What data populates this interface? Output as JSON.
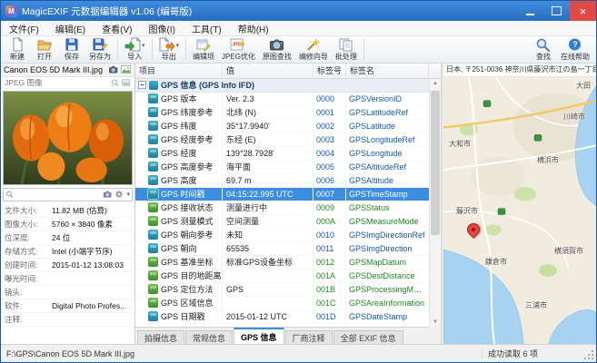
{
  "window": {
    "title": "MagicEXIF 元数据编辑器 v1.06 (编哥版)"
  },
  "menu": {
    "items": [
      "文件(F)",
      "编辑(E)",
      "查看(V)",
      "图像(I)",
      "工具(T)",
      "帮助(H)"
    ]
  },
  "toolbar": {
    "new": "新建",
    "open": "打开",
    "save": "保存",
    "save_as": "另存为",
    "import": "导入",
    "export": "导出",
    "edit_items": "编辑项",
    "jpeg_optimize": "JPEG优化",
    "original_search": "原图查找",
    "wizard": "编修向导",
    "batch": "批处理",
    "find": "查找",
    "online_help": "在线帮助"
  },
  "left": {
    "filename": "Canon EOS 5D Mark III.jpg",
    "filetype": "JPEG 图像",
    "search": {
      "value": "",
      "placeholder": ""
    },
    "props": [
      {
        "label": "文件大小:",
        "value": "11.82 MB (估算)"
      },
      {
        "label": "图像大小:",
        "value": "5760 × 3840 像素"
      },
      {
        "label": "位深度:",
        "value": "24 位"
      },
      {
        "label": "存储方式:",
        "value": "Intel (小端字节序)"
      },
      {
        "label": "创建时间:",
        "value": "2015-01-12 13:08:03"
      },
      {
        "label": "曝光时间:",
        "value": ""
      },
      {
        "label": "镜头:",
        "value": ""
      },
      {
        "label": "软件:",
        "value": "Digital Photo Profes..."
      },
      {
        "label": "注释:",
        "value": ""
      }
    ]
  },
  "table": {
    "headers": [
      "项目",
      "值",
      "标签号",
      "标签名"
    ],
    "group": "GPS 信息 (GPS Info IFD)",
    "rows": [
      {
        "item": "GPS 版本",
        "value": "Ver. 2.3",
        "tag": "0000",
        "name": "GPSVersionID",
        "cls": "c-blue"
      },
      {
        "item": "GPS 纬度参考",
        "value": "北纬 (N)",
        "tag": "0001",
        "name": "GPSLatitudeRef",
        "cls": "c-blue"
      },
      {
        "item": "GPS 纬度",
        "value": "35°17.9940'",
        "tag": "0002",
        "name": "GPSLatitude",
        "cls": "c-blue"
      },
      {
        "item": "GPS 经度参考",
        "value": "东经 (E)",
        "tag": "0003",
        "name": "GPSLongitudeRef",
        "cls": "c-blue"
      },
      {
        "item": "GPS 经度",
        "value": "139°28.7928'",
        "tag": "0004",
        "name": "GPSLongitude",
        "cls": "c-blue"
      },
      {
        "item": "GPS 高度参考",
        "value": "海平面",
        "tag": "0005",
        "name": "GPSAltitudeRef",
        "cls": "c-blue"
      },
      {
        "item": "GPS 高度",
        "value": "69.7 m",
        "tag": "0006",
        "name": "GPSAltitude",
        "cls": "c-blue"
      },
      {
        "item": "GPS 时间戳",
        "value": "04:15:22.995 UTC",
        "tag": "0007",
        "name": "GPSTimeStamp",
        "cls": "c-blue selected"
      },
      {
        "item": "GPS 接收状态",
        "value": "测量进行中",
        "tag": "0009",
        "name": "GPSStatus",
        "cls": "c-green"
      },
      {
        "item": "GPS 测量模式",
        "value": "空间测量",
        "tag": "000A",
        "name": "GPSMeasureMode",
        "cls": "c-green"
      },
      {
        "item": "GPS 朝向参考",
        "value": "未知",
        "tag": "0010",
        "name": "GPSImgDirectionRef",
        "cls": "c-blue"
      },
      {
        "item": "GPS 朝向",
        "value": "65535",
        "tag": "0011",
        "name": "GPSImgDirection",
        "cls": "c-blue"
      },
      {
        "item": "GPS 基准坐标",
        "value": "标准GPS设备坐标",
        "tag": "0012",
        "name": "GPSMapDatum",
        "cls": "c-green"
      },
      {
        "item": "GPS 目的地距离",
        "value": "",
        "tag": "001A",
        "name": "GPSDestDistance",
        "cls": "c-green"
      },
      {
        "item": "GPS 定位方法",
        "value": "GPS",
        "tag": "001B",
        "name": "GPSProcessingMethod",
        "cls": "c-green"
      },
      {
        "item": "GPS 区域信息",
        "value": "",
        "tag": "001C",
        "name": "GPSAreaInformation",
        "cls": "c-green"
      },
      {
        "item": "GPS 日期戳",
        "value": "2015-01-12 UTC",
        "tag": "001D",
        "name": "GPSDateStamp",
        "cls": "c-blue"
      }
    ]
  },
  "tabs": {
    "items": [
      {
        "label": "拍摄信息",
        "cls": ""
      },
      {
        "label": "常规信息",
        "cls": ""
      },
      {
        "label": "GPS 信息",
        "cls": "active"
      },
      {
        "label": "厂商注释",
        "cls": ""
      },
      {
        "label": "全部 EXIF 信息",
        "cls": ""
      }
    ]
  },
  "map": {
    "address": "日本, 〒251-0036 神奈川県藤沢市江の島一丁目",
    "labels": [
      "大田",
      "川崎市",
      "大和市",
      "横浜市",
      "藤沢市",
      "鎌倉市",
      "横須賀市",
      "三浦市"
    ],
    "pin_color": "#e8453c"
  },
  "status": {
    "path": "F:\\GPS\\Canon EOS 5D Mark III.jpg",
    "message": "成功读取 6 项"
  },
  "icons": {
    "new": "blank-document",
    "open": "folder",
    "save": "floppy-disk",
    "save_as": "floppy-disk-pencil",
    "import": "page-arrow-in",
    "export": "page-arrow-out",
    "edit_items": "grid-pencil",
    "jpeg_optimize": "jpeg-sparkle",
    "original_search": "camera",
    "wizard": "magic-wand",
    "batch": "stacked-pages",
    "find": "magnifier",
    "online_help": "question-circle",
    "map_pin": "red-pin",
    "search": "magnifier",
    "gear": "gear"
  }
}
